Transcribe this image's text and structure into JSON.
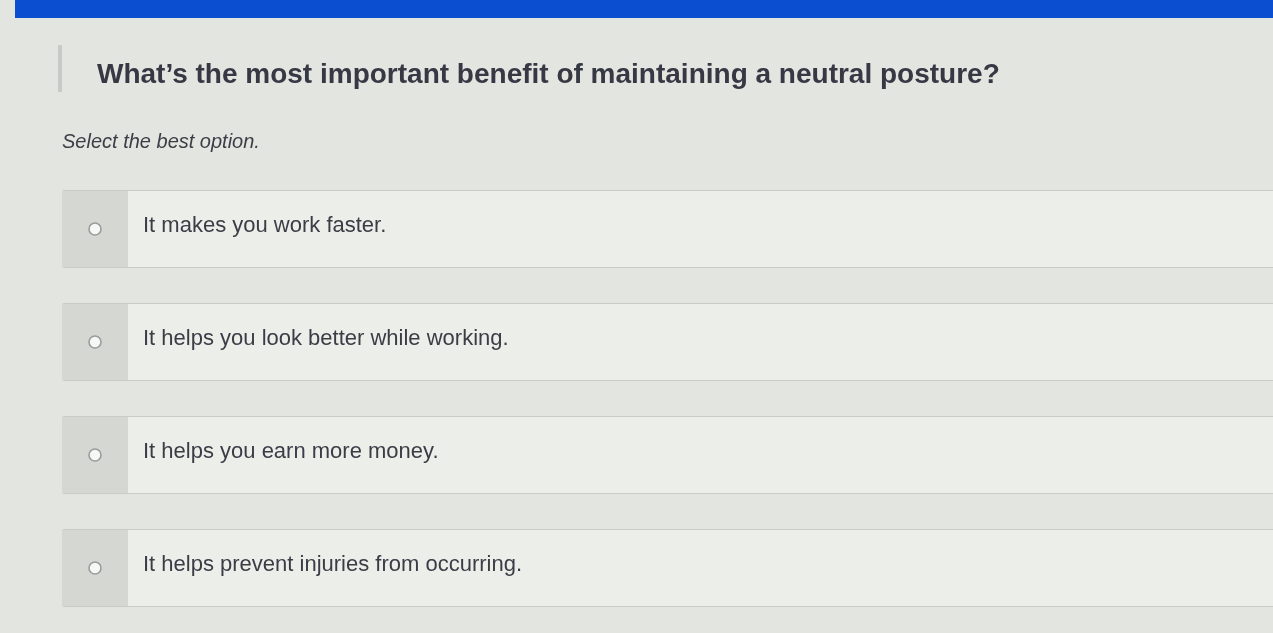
{
  "question": {
    "text": "What’s the most important benefit of maintaining a neutral posture?"
  },
  "instruction": "Select the best option.",
  "options": [
    {
      "label": "It makes you work faster.",
      "selected": false
    },
    {
      "label": "It helps you look better while working.",
      "selected": false
    },
    {
      "label": "It helps you earn more money.",
      "selected": false
    },
    {
      "label": "It helps prevent injuries from occurring.",
      "selected": false
    }
  ]
}
